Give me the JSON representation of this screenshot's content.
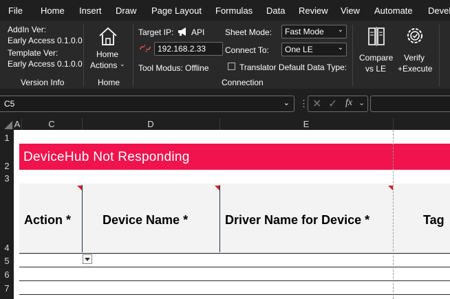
{
  "menu": [
    "File",
    "Home",
    "Insert",
    "Draw",
    "Page Layout",
    "Formulas",
    "Data",
    "Review",
    "View",
    "Automate",
    "Devel"
  ],
  "ribbon": {
    "version_info": {
      "addin_label": "AddIn Ver:",
      "addin_value": "Early Access 0.1.0.0",
      "template_label": "Template Ver:",
      "template_value": "Early Access 0.1.0.0",
      "group_label": "Version Info"
    },
    "home": {
      "label_line1": "Home",
      "label_line2": "Actions",
      "group_label": "Home"
    },
    "connection": {
      "target_ip_label": "Target IP:",
      "api_label": "API",
      "ip_value": "192.168.2.33",
      "tool_modus": "Tool Modus: Offline",
      "sheet_mode_label": "Sheet Mode:",
      "sheet_mode_value": "Fast Mode",
      "connect_to_label": "Connect To:",
      "connect_to_value": "One LE",
      "translator_label": "Translator Default Data Type:",
      "group_label": "Connection"
    },
    "compare": {
      "line1": "Compare",
      "line2": "vs LE"
    },
    "verify": {
      "line1": "Verify",
      "line2": "+Execute"
    }
  },
  "formula_bar": {
    "name_box": "C5",
    "fx": "fx"
  },
  "columns": [
    "A",
    "C",
    "D",
    "E"
  ],
  "rows": [
    "1",
    "2",
    "3",
    "4",
    "5",
    "6",
    "7"
  ],
  "sheet": {
    "banner": "DeviceHub Not Responding",
    "headers": [
      "Action *",
      "Device Name *",
      "Driver Name for Device *",
      "Tag"
    ]
  },
  "colors": {
    "banner": "#f0134d",
    "ribbon_bg": "#292929",
    "menubar_bg": "#1f1f1f"
  }
}
